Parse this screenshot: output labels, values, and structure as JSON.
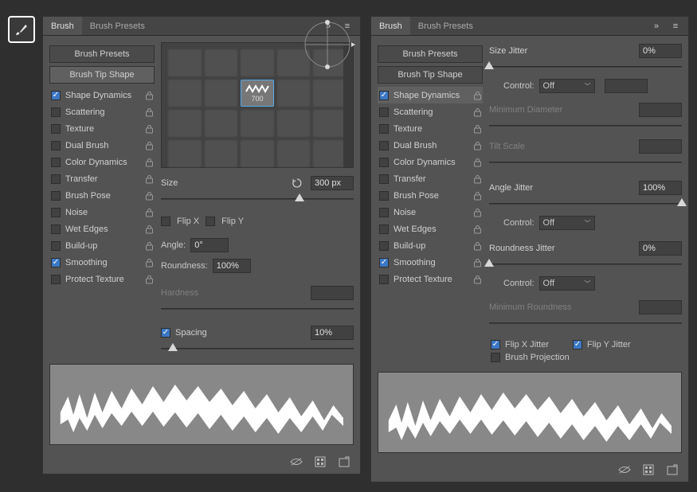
{
  "tabs": {
    "brush": "Brush",
    "presets": "Brush Presets"
  },
  "buttons": {
    "presets": "Brush Presets",
    "tipshape": "Brush Tip Shape"
  },
  "options": [
    {
      "label": "Shape Dynamics",
      "checked": true,
      "lock": true
    },
    {
      "label": "Scattering",
      "checked": false,
      "lock": true
    },
    {
      "label": "Texture",
      "checked": false,
      "lock": true
    },
    {
      "label": "Dual Brush",
      "checked": false,
      "lock": true
    },
    {
      "label": "Color Dynamics",
      "checked": false,
      "lock": true
    },
    {
      "label": "Transfer",
      "checked": false,
      "lock": true
    },
    {
      "label": "Brush Pose",
      "checked": false,
      "lock": true
    },
    {
      "label": "Noise",
      "checked": false,
      "lock": true
    },
    {
      "label": "Wet Edges",
      "checked": false,
      "lock": true
    },
    {
      "label": "Build-up",
      "checked": false,
      "lock": true
    },
    {
      "label": "Smoothing",
      "checked": true,
      "lock": true
    },
    {
      "label": "Protect Texture",
      "checked": false,
      "lock": true
    }
  ],
  "tip": {
    "selected_size": "700",
    "size_label": "Size",
    "size_value": "300 px",
    "flipx": "Flip X",
    "flipy": "Flip Y",
    "angle_label": "Angle:",
    "angle_value": "0°",
    "round_label": "Roundness:",
    "round_value": "100%",
    "hardness_label": "Hardness",
    "spacing_label": "Spacing",
    "spacing_value": "10%"
  },
  "dyn": {
    "size_jitter": "Size Jitter",
    "size_jitter_v": "0%",
    "control": "Control:",
    "off": "Off",
    "min_diam": "Minimum Diameter",
    "tilt": "Tilt Scale",
    "angle_jitter": "Angle Jitter",
    "angle_jitter_v": "100%",
    "round_jitter": "Roundness Jitter",
    "round_jitter_v": "0%",
    "min_round": "Minimum Roundness",
    "flipx": "Flip X Jitter",
    "flipy": "Flip Y Jitter",
    "proj": "Brush Projection"
  }
}
